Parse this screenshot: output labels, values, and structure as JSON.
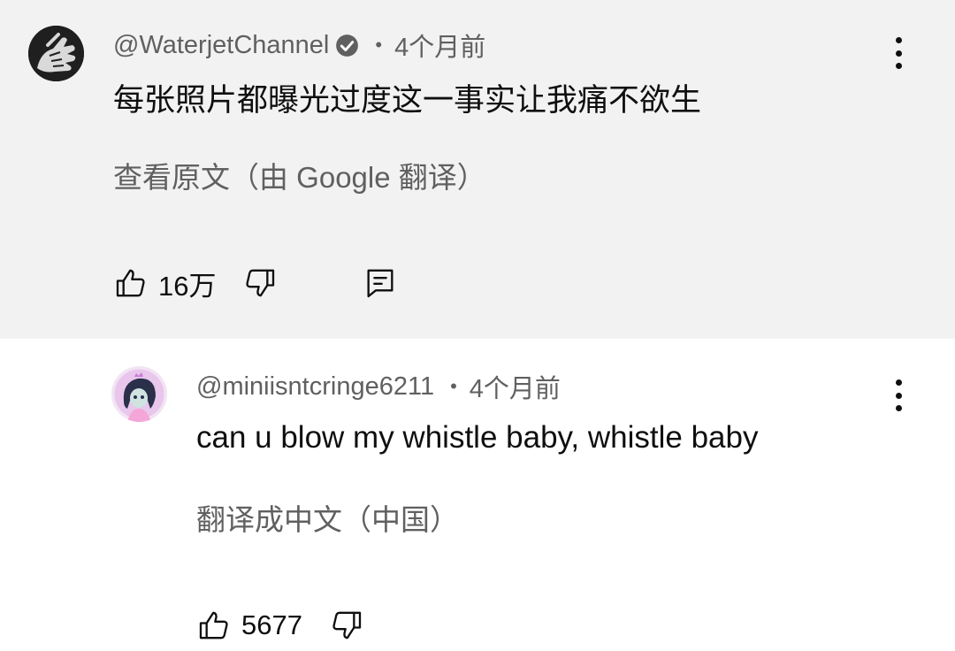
{
  "comments": [
    {
      "username": "@WaterjetChannel",
      "verified": true,
      "separator": "•",
      "time": "4个月前",
      "text": "每张照片都曝光过度这一事实让我痛不欲生",
      "translate_link": "查看原文（由 Google 翻译）",
      "likes": "16万",
      "icons": {
        "avatar": "black-fist-avatar",
        "verified": "verified-check-icon",
        "menu": "kebab-menu-icon",
        "like": "thumbs-up-icon",
        "dislike": "thumbs-down-icon",
        "reply": "comment-reply-icon"
      }
    },
    {
      "username": "@miniisntcringe6211",
      "verified": false,
      "separator": "•",
      "time": "4个月前",
      "text": "can u blow my whistle baby, whistle baby",
      "translate_link": "翻译成中文（中国）",
      "likes": "5677",
      "icons": {
        "avatar": "anime-character-avatar",
        "menu": "kebab-menu-icon",
        "like": "thumbs-up-icon",
        "dislike": "thumbs-down-icon"
      }
    }
  ],
  "colors": {
    "top_comment_bg": "#f2f2f2",
    "reply_bg": "#ffffff",
    "secondary_text": "#606060",
    "primary_text": "#0f0f0f"
  }
}
